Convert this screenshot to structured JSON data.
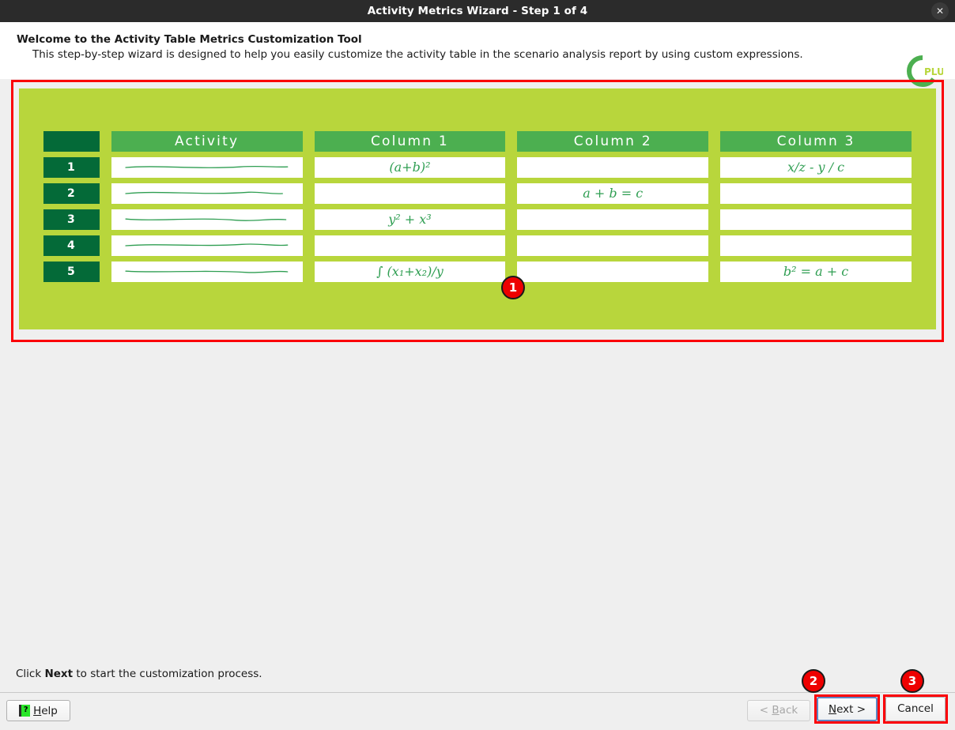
{
  "window": {
    "title": "Activity Metrics Wizard - Step 1 of 4",
    "close_icon": "close-icon",
    "close_glyph": "✕"
  },
  "header": {
    "title": "Welcome to the Activity Table Metrics Customization Tool",
    "subtitle": "This step-by-step wizard is designed to help you easily customize the activity table in the scenario analysis report by using custom expressions.",
    "logo_text": "PLUS",
    "logo_name": "cplus-logo"
  },
  "table": {
    "columns": [
      "",
      "Activity",
      "Column 1",
      "Column 2",
      "Column 3"
    ],
    "rows": [
      {
        "index": "1",
        "activity": "",
        "col1": "(a+b)²",
        "col2": "",
        "col3": "x/z - y / c"
      },
      {
        "index": "2",
        "activity": "",
        "col1": "",
        "col2": "a + b = c",
        "col3": ""
      },
      {
        "index": "3",
        "activity": "",
        "col1": "y² + x³",
        "col2": "",
        "col3": ""
      },
      {
        "index": "4",
        "activity": "",
        "col1": "",
        "col2": "",
        "col3": ""
      },
      {
        "index": "5",
        "activity": "",
        "col1": "∫ (x₁+x₂)/y",
        "col2": "",
        "col3": "b² = a + c"
      }
    ]
  },
  "footer": {
    "hint_prefix": "Click ",
    "hint_bold": "Next",
    "hint_suffix": " to start the customization process.",
    "help_label": "Help",
    "help_icon": "help-question-icon",
    "help_glyph": "?",
    "back_label": "< Back",
    "next_label": "Next >",
    "cancel_label": "Cancel"
  },
  "annotations": {
    "badges": [
      "1",
      "2",
      "3"
    ],
    "color": "#fb0007"
  },
  "colors": {
    "panel_green": "#b8d63c",
    "header_green": "#4caf50",
    "dark_green": "#046a38",
    "formula_green": "#2f9e52",
    "titlebar": "#2b2b2b",
    "page_bg": "#efefef"
  }
}
